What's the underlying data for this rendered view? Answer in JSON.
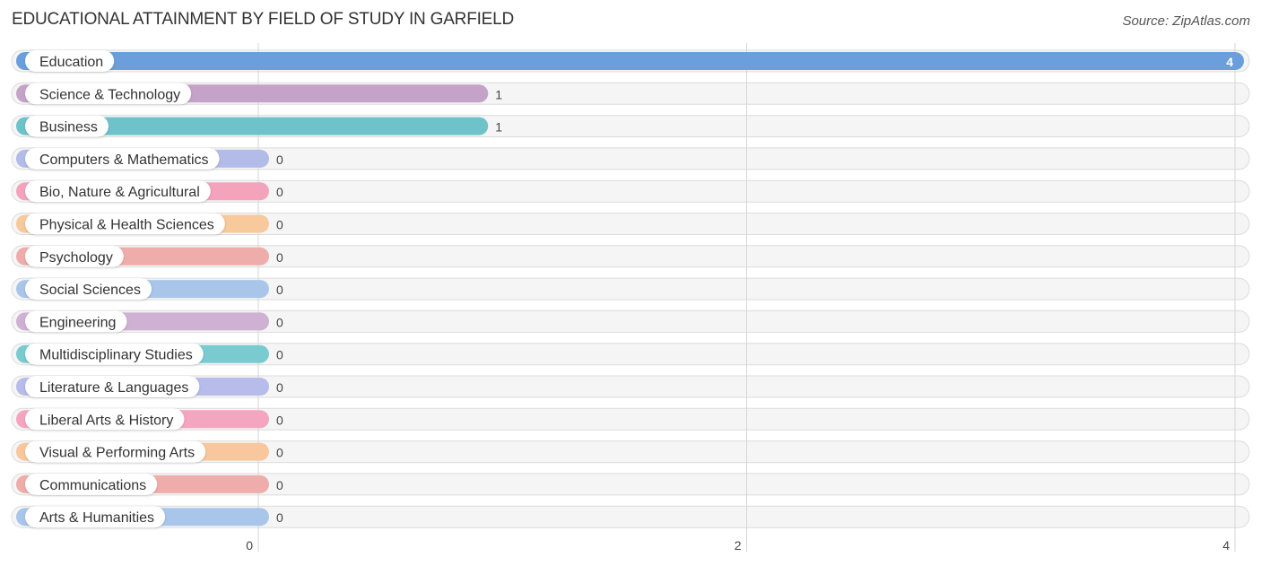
{
  "header": {
    "title": "EDUCATIONAL ATTAINMENT BY FIELD OF STUDY IN GARFIELD",
    "source": "Source: ZipAtlas.com"
  },
  "chart_data": {
    "type": "bar",
    "orientation": "horizontal",
    "title": "EDUCATIONAL ATTAINMENT BY FIELD OF STUDY IN GARFIELD",
    "xlabel": "",
    "ylabel": "",
    "xlim": [
      0,
      4
    ],
    "x_ticks": [
      0,
      2,
      4
    ],
    "grid": true,
    "categories": [
      "Education",
      "Science & Technology",
      "Business",
      "Computers & Mathematics",
      "Bio, Nature & Agricultural",
      "Physical & Health Sciences",
      "Psychology",
      "Social Sciences",
      "Engineering",
      "Multidisciplinary Studies",
      "Literature & Languages",
      "Liberal Arts & History",
      "Visual & Performing Arts",
      "Communications",
      "Arts & Humanities"
    ],
    "values": [
      4,
      1,
      1,
      0,
      0,
      0,
      0,
      0,
      0,
      0,
      0,
      0,
      0,
      0,
      0
    ],
    "colors": [
      "#6a9fdc",
      "#c5a3c9",
      "#6ec3cb",
      "#b3bbe9",
      "#f4a3bd",
      "#f8c99a",
      "#eeadaa",
      "#a9c6ea",
      "#cfb1d3",
      "#7acbd0",
      "#b7bcea",
      "#f4a6c0",
      "#f8c79d",
      "#eeadaa",
      "#a9c6ea"
    ]
  }
}
